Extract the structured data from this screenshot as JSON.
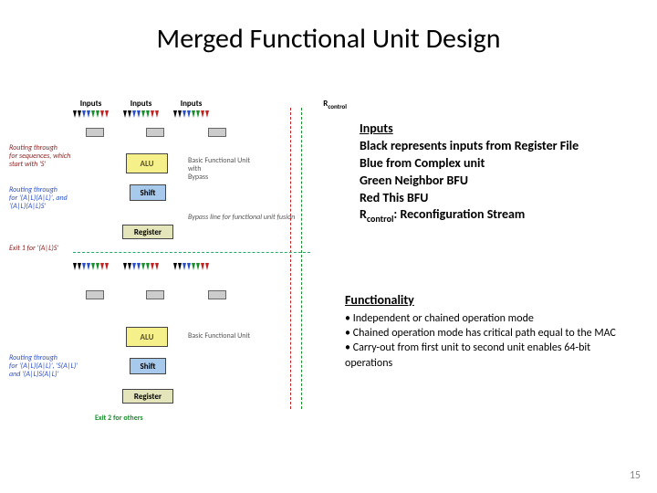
{
  "title": "Merged Functional Unit Design",
  "page_number": "15",
  "legend": {
    "heading": "Inputs",
    "black": "Black represents inputs from Register File",
    "blue": "Blue from Complex unit",
    "green": "Green Neighbor BFU",
    "red": "Red This BFU",
    "rcontrol_prefix": "R",
    "rcontrol_sub": "control",
    "rcontrol_suffix": ": Reconfiguration Stream"
  },
  "functionality": {
    "heading": "Functionality",
    "items": [
      "• Independent or chained operation mode",
      "• Chained operation mode has critical path equal to the MAC",
      "• Carry-out from first unit to second unit enables 64-bit operations"
    ]
  },
  "diagram": {
    "inputs_label": "Inputs",
    "rcontrol_label": "R",
    "rcontrol_sub": "control",
    "alu_label": "ALU",
    "shift_label": "Shift",
    "register_label": "Register",
    "bfu_label_line1": "Basic Functional Unit",
    "bfu_label_line2": "with",
    "bfu_label_line3": "Bypass",
    "bfu_label2": "Basic Functional Unit",
    "bypass_note": "Bypass line for functional unit fusion",
    "route_seq_line1": "Routing through",
    "route_seq_line2": "for sequences, which",
    "route_seq_line3": "start with 'S'",
    "route_al_line1": "Routing through",
    "route_al_line2": "for '(A|L)(A|L)', and '(A|L)(A|L)S'",
    "exit1": "Exit 1 for '(A|L)S'",
    "route2_line1": "Routing through",
    "route2_line2": "for '(A|L)(A|L)', 'S(A|L)'",
    "route2_line3": "and '(A|L)S(A|L)'",
    "exit2": "Exit 2 for others"
  }
}
